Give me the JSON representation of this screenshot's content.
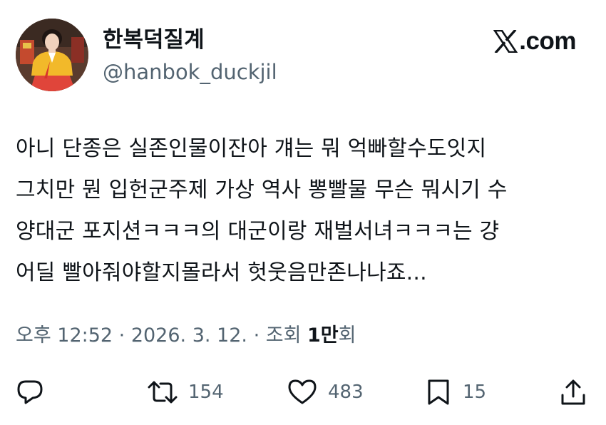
{
  "user": {
    "display_name": "한복덕질계",
    "handle": "@hanbok_duckjil",
    "avatar_icon": "profile-photo-hanbok"
  },
  "brand": {
    "logo_icon": "x-logo-icon",
    "suffix": ".com"
  },
  "tweet": {
    "lines": [
      "아니 단종은 실존인물이잔아 걔는 뭐 억빠할수도잇지",
      "그치만 뭔 입헌군주제 가상 역사 뽕빨물 무슨 뭐시기 수",
      "양대군 포지션ㅋㅋㅋ의 대군이랑 재벌서녀ㅋㅋㅋ는 걍",
      "어딜 빨아줘야할지몰라서 헛웃음만존나나죠..."
    ]
  },
  "meta": {
    "time": "오후 12:52",
    "sep1": " · ",
    "date": "2026. 3. 12.",
    "sep2": " · ",
    "views_label": "조회 ",
    "views_count": "1만",
    "views_suffix": "회"
  },
  "actions": {
    "reply": {
      "icon": "reply-icon"
    },
    "retweet": {
      "icon": "retweet-icon",
      "count": "154"
    },
    "like": {
      "icon": "heart-icon",
      "count": "483"
    },
    "bookmark": {
      "icon": "bookmark-icon",
      "count": "15"
    },
    "share": {
      "icon": "share-icon"
    }
  },
  "colors": {
    "text": "#0f1419",
    "secondary": "#536471",
    "background": "#ffffff"
  }
}
